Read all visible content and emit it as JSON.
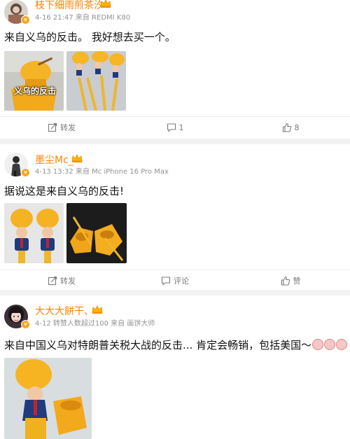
{
  "posts": [
    {
      "username": "枝下细雨煎茶汐",
      "meta": "4-16 21:47 来自 REDMI K80",
      "content": "来自义乌的反击。 我好想去买一个。",
      "images": [
        {
          "icon": "trump-toilet-brush-photo",
          "overlay": "义乌的反击"
        },
        {
          "icon": "toilet-brush-bundle-photo"
        }
      ],
      "actions": {
        "repost": "转发",
        "comment": "1",
        "like": "8"
      }
    },
    {
      "username": "墨尘Mc_",
      "meta": "4-13 13:32 来自 Mc iPhone 16 Pro Max",
      "content": "据说这是来自义乌的反击!",
      "images": [
        {
          "icon": "trump-toilet-brush-pair-photo"
        },
        {
          "icon": "toilet-brush-holders-photo"
        }
      ],
      "actions": {
        "repost": "转发",
        "comment": "评论",
        "like": "赞"
      }
    },
    {
      "username": "大大大餅干、",
      "meta": "4-12 转赞人数超过100 来自 画饼大师",
      "content": "来自中国义乌对特朗普关税大战的反击... 肯定会畅销，包括美国～",
      "images": [
        {
          "icon": "trump-toilet-brush-holder-photo"
        }
      ]
    }
  ],
  "colors": {
    "username": "#ff8200",
    "meta": "#939393",
    "action": "#7a7a7a",
    "background": "#f2f2f2"
  }
}
